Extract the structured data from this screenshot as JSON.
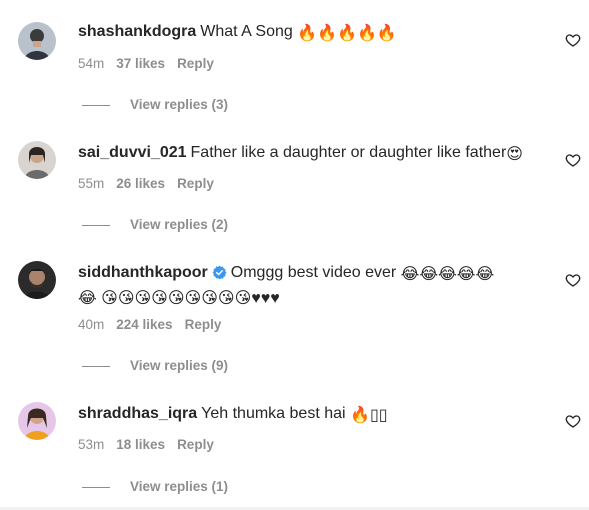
{
  "comments": [
    {
      "username": "shashankdogra",
      "verified": false,
      "text": "What A Song",
      "emoji": "🔥🔥🔥🔥🔥",
      "text2": "",
      "time": "54m",
      "likes": "37 likes",
      "reply": "Reply",
      "view_replies": "View replies (3)"
    },
    {
      "username": "sai_duvvi_021",
      "verified": false,
      "text": "Father like a daughter or daughter like father",
      "emoji": "😍",
      "text2": "",
      "time": "55m",
      "likes": "26 likes",
      "reply": "Reply",
      "view_replies": "View replies (2)"
    },
    {
      "username": "siddhanthkapoor",
      "verified": true,
      "text": "Omggg best video ever",
      "emoji": "😂😂😂😂😂",
      "text2": "😂 😘😘😘😘😘😘😘😘😘♥♥♥",
      "time": "40m",
      "likes": "224 likes",
      "reply": "Reply",
      "view_replies": "View replies (9)"
    },
    {
      "username": "shraddhas_iqra",
      "verified": false,
      "text": "Yeh thumka best hai",
      "emoji": "🔥▯▯",
      "text2": "",
      "time": "53m",
      "likes": "18 likes",
      "reply": "Reply",
      "view_replies": "View replies (1)"
    }
  ],
  "colors": {
    "text": "#262626",
    "secondary": "#8e8e8e",
    "verified": "#3897f0"
  },
  "icons": {
    "like": "heart-outline-icon",
    "verified": "verified-badge-icon"
  }
}
